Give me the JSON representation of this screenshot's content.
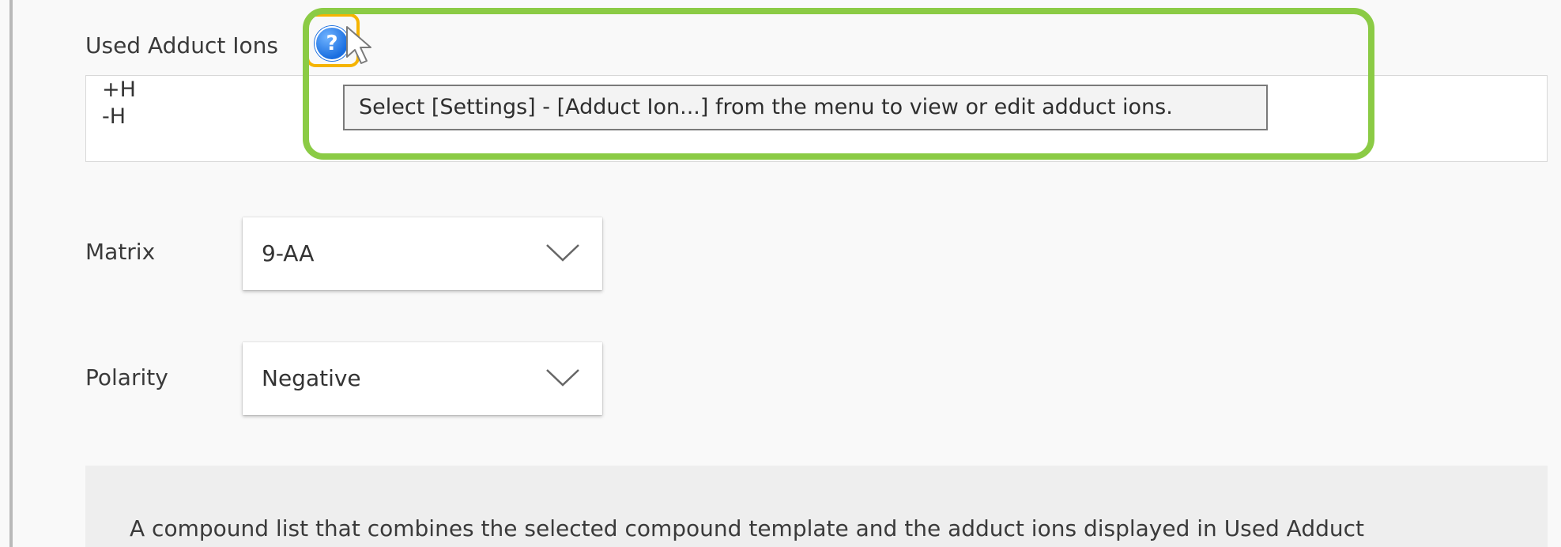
{
  "adduct_section": {
    "label": "Used Adduct Ions",
    "help_icon": "help-question-icon",
    "items": [
      "+H",
      "-H"
    ]
  },
  "tooltip": {
    "text": "Select [Settings] - [Adduct Ion...] from the menu to view or edit adduct ions."
  },
  "matrix": {
    "label": "Matrix",
    "value": "9-AA",
    "icon": "chevron-down-icon"
  },
  "polarity": {
    "label": "Polarity",
    "value": "Negative",
    "icon": "chevron-down-icon"
  },
  "info": {
    "text": "A compound list that combines the selected compound template and the adduct ions displayed in Used Adduct"
  },
  "colors": {
    "callout_border": "#8bcb45",
    "help_highlight": "#f5b400",
    "help_icon_fill": "#1a6ee0"
  }
}
